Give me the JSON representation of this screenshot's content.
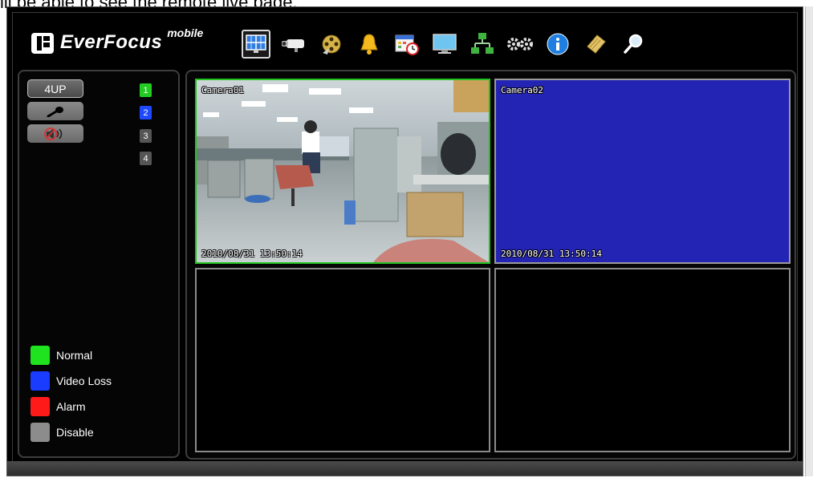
{
  "caption": "ill be able to see the remote live page.",
  "brand": {
    "name": "EverFocus",
    "sub": "mobile"
  },
  "toolbar": [
    {
      "icon": "live-view-grid-icon",
      "active": true
    },
    {
      "icon": "camera-icon"
    },
    {
      "icon": "film-reel-icon"
    },
    {
      "icon": "alarm-bell-icon"
    },
    {
      "icon": "calendar-clock-icon"
    },
    {
      "icon": "monitor-icon"
    },
    {
      "icon": "network-icon"
    },
    {
      "icon": "gears-icon"
    },
    {
      "icon": "info-icon"
    },
    {
      "icon": "notes-icon"
    },
    {
      "icon": "search-icon"
    }
  ],
  "left_panel": {
    "split_button": "4UP",
    "channels": [
      {
        "label": "1",
        "color": "#22cc22"
      },
      {
        "label": "2",
        "color": "#1f49ff"
      },
      {
        "label": "3",
        "color": "#555555"
      },
      {
        "label": "4",
        "color": "#555555"
      }
    ],
    "legend": [
      {
        "label": "Normal",
        "color": "#1ee31e"
      },
      {
        "label": "Video Loss",
        "color": "#1a3cff"
      },
      {
        "label": "Alarm",
        "color": "#ff1a1a"
      },
      {
        "label": "Disable",
        "color": "#8c8c8c"
      }
    ]
  },
  "cameras": [
    {
      "name": "Camera01",
      "timestamp": "2010/08/31  13:50:14",
      "state": "normal",
      "border": "#22c222"
    },
    {
      "name": "Camera02",
      "timestamp": "2010/08/31  13:50:14",
      "state": "video-loss",
      "background": "#2424b4",
      "border": "#9a9a9a"
    },
    {
      "name": "",
      "timestamp": "",
      "state": "disabled",
      "border": "#8a8a8a"
    },
    {
      "name": "",
      "timestamp": "",
      "state": "disabled",
      "border": "#8a8a8a"
    }
  ]
}
